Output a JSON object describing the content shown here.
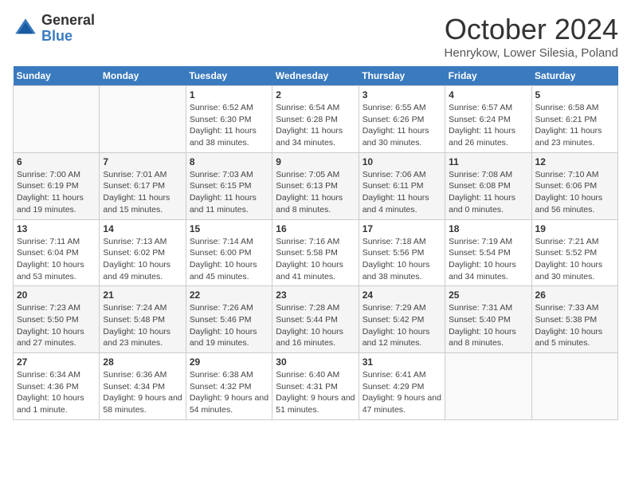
{
  "logo": {
    "general": "General",
    "blue": "Blue"
  },
  "title": "October 2024",
  "location": "Henrykow, Lower Silesia, Poland",
  "weekdays": [
    "Sunday",
    "Monday",
    "Tuesday",
    "Wednesday",
    "Thursday",
    "Friday",
    "Saturday"
  ],
  "weeks": [
    [
      {
        "day": "",
        "info": ""
      },
      {
        "day": "",
        "info": ""
      },
      {
        "day": "1",
        "info": "Sunrise: 6:52 AM\nSunset: 6:30 PM\nDaylight: 11 hours and 38 minutes."
      },
      {
        "day": "2",
        "info": "Sunrise: 6:54 AM\nSunset: 6:28 PM\nDaylight: 11 hours and 34 minutes."
      },
      {
        "day": "3",
        "info": "Sunrise: 6:55 AM\nSunset: 6:26 PM\nDaylight: 11 hours and 30 minutes."
      },
      {
        "day": "4",
        "info": "Sunrise: 6:57 AM\nSunset: 6:24 PM\nDaylight: 11 hours and 26 minutes."
      },
      {
        "day": "5",
        "info": "Sunrise: 6:58 AM\nSunset: 6:21 PM\nDaylight: 11 hours and 23 minutes."
      }
    ],
    [
      {
        "day": "6",
        "info": "Sunrise: 7:00 AM\nSunset: 6:19 PM\nDaylight: 11 hours and 19 minutes."
      },
      {
        "day": "7",
        "info": "Sunrise: 7:01 AM\nSunset: 6:17 PM\nDaylight: 11 hours and 15 minutes."
      },
      {
        "day": "8",
        "info": "Sunrise: 7:03 AM\nSunset: 6:15 PM\nDaylight: 11 hours and 11 minutes."
      },
      {
        "day": "9",
        "info": "Sunrise: 7:05 AM\nSunset: 6:13 PM\nDaylight: 11 hours and 8 minutes."
      },
      {
        "day": "10",
        "info": "Sunrise: 7:06 AM\nSunset: 6:11 PM\nDaylight: 11 hours and 4 minutes."
      },
      {
        "day": "11",
        "info": "Sunrise: 7:08 AM\nSunset: 6:08 PM\nDaylight: 11 hours and 0 minutes."
      },
      {
        "day": "12",
        "info": "Sunrise: 7:10 AM\nSunset: 6:06 PM\nDaylight: 10 hours and 56 minutes."
      }
    ],
    [
      {
        "day": "13",
        "info": "Sunrise: 7:11 AM\nSunset: 6:04 PM\nDaylight: 10 hours and 53 minutes."
      },
      {
        "day": "14",
        "info": "Sunrise: 7:13 AM\nSunset: 6:02 PM\nDaylight: 10 hours and 49 minutes."
      },
      {
        "day": "15",
        "info": "Sunrise: 7:14 AM\nSunset: 6:00 PM\nDaylight: 10 hours and 45 minutes."
      },
      {
        "day": "16",
        "info": "Sunrise: 7:16 AM\nSunset: 5:58 PM\nDaylight: 10 hours and 41 minutes."
      },
      {
        "day": "17",
        "info": "Sunrise: 7:18 AM\nSunset: 5:56 PM\nDaylight: 10 hours and 38 minutes."
      },
      {
        "day": "18",
        "info": "Sunrise: 7:19 AM\nSunset: 5:54 PM\nDaylight: 10 hours and 34 minutes."
      },
      {
        "day": "19",
        "info": "Sunrise: 7:21 AM\nSunset: 5:52 PM\nDaylight: 10 hours and 30 minutes."
      }
    ],
    [
      {
        "day": "20",
        "info": "Sunrise: 7:23 AM\nSunset: 5:50 PM\nDaylight: 10 hours and 27 minutes."
      },
      {
        "day": "21",
        "info": "Sunrise: 7:24 AM\nSunset: 5:48 PM\nDaylight: 10 hours and 23 minutes."
      },
      {
        "day": "22",
        "info": "Sunrise: 7:26 AM\nSunset: 5:46 PM\nDaylight: 10 hours and 19 minutes."
      },
      {
        "day": "23",
        "info": "Sunrise: 7:28 AM\nSunset: 5:44 PM\nDaylight: 10 hours and 16 minutes."
      },
      {
        "day": "24",
        "info": "Sunrise: 7:29 AM\nSunset: 5:42 PM\nDaylight: 10 hours and 12 minutes."
      },
      {
        "day": "25",
        "info": "Sunrise: 7:31 AM\nSunset: 5:40 PM\nDaylight: 10 hours and 8 minutes."
      },
      {
        "day": "26",
        "info": "Sunrise: 7:33 AM\nSunset: 5:38 PM\nDaylight: 10 hours and 5 minutes."
      }
    ],
    [
      {
        "day": "27",
        "info": "Sunrise: 6:34 AM\nSunset: 4:36 PM\nDaylight: 10 hours and 1 minute."
      },
      {
        "day": "28",
        "info": "Sunrise: 6:36 AM\nSunset: 4:34 PM\nDaylight: 9 hours and 58 minutes."
      },
      {
        "day": "29",
        "info": "Sunrise: 6:38 AM\nSunset: 4:32 PM\nDaylight: 9 hours and 54 minutes."
      },
      {
        "day": "30",
        "info": "Sunrise: 6:40 AM\nSunset: 4:31 PM\nDaylight: 9 hours and 51 minutes."
      },
      {
        "day": "31",
        "info": "Sunrise: 6:41 AM\nSunset: 4:29 PM\nDaylight: 9 hours and 47 minutes."
      },
      {
        "day": "",
        "info": ""
      },
      {
        "day": "",
        "info": ""
      }
    ]
  ]
}
